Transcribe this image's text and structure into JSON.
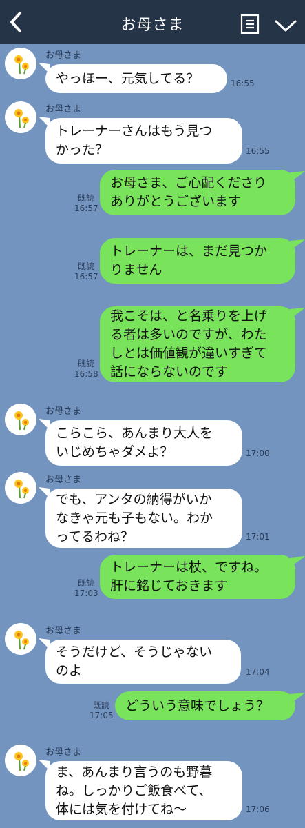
{
  "header": {
    "title": "お母さま"
  },
  "messages": [
    {
      "side": "in",
      "sender": "お母さま",
      "text": "やっほー、元気してる？",
      "time": "16:55"
    },
    {
      "side": "in",
      "sender": "お母さま",
      "text": "トレーナーさんはもう見つ\nかった？",
      "time": "16:55"
    },
    {
      "side": "out",
      "read": "既読",
      "text": "お母さま、ご心配くださり\nありがとうございます",
      "time": "16:57"
    },
    {
      "side": "out",
      "read": "既読",
      "text": "トレーナーは、まだ見つか\nりません",
      "time": "16:57"
    },
    {
      "side": "out",
      "read": "既読",
      "text": "我こそは、と名乗りを上げ\nる者は多いのですが、わた\nしとは価値観が違いすぎて\n話にならないのです",
      "time": "16:58"
    },
    {
      "side": "in",
      "sender": "お母さま",
      "text": "こらこら、あんまり大人を\nいじめちゃダメよ？",
      "time": "17:00"
    },
    {
      "side": "in",
      "sender": "お母さま",
      "text": "でも、アンタの納得がいか\nなきゃ元も子もない。わか\nってるわね？",
      "time": "17:01"
    },
    {
      "side": "out",
      "read": "既読",
      "text": "トレーナーは杖、ですね。\n肝に銘じておきます",
      "time": "17:03"
    },
    {
      "side": "in",
      "sender": "お母さま",
      "text": "そうだけど、そうじゃない\nのよ",
      "time": "17:04"
    },
    {
      "side": "out",
      "read": "既読",
      "text": "どういう意味でしょう？",
      "time": "17:05"
    },
    {
      "side": "in",
      "sender": "お母さま",
      "text": "ま、あんまり言うのも野暮\nね。しっかりご飯食べて、\n体には気を付けてね〜",
      "time": "17:06"
    }
  ]
}
